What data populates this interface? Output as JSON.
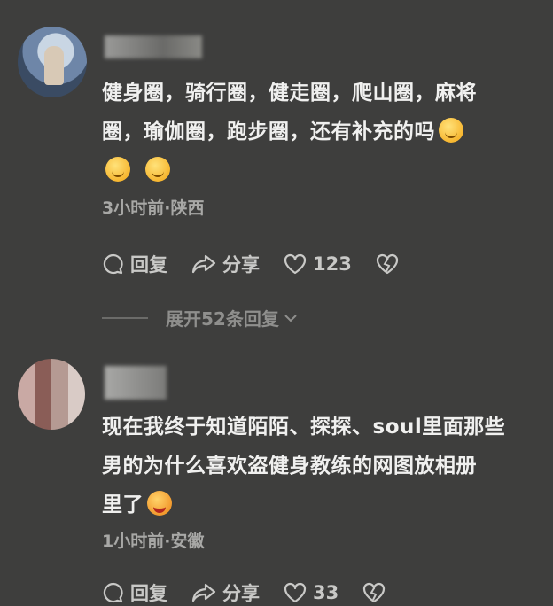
{
  "comments": [
    {
      "content_line1": "健身圈，骑行圈，健走圈，爬山圈，麻将",
      "content_line2": "圈，瑜伽圈，跑步圈，还有补充的吗",
      "meta": "3小时前·陕西",
      "reply_label": "回复",
      "share_label": "分享",
      "like_count": "123",
      "expand_label": "展开52条回复"
    },
    {
      "content_line1": "现在我终于知道陌陌、探探、soul里面那些",
      "content_line2": "男的为什么喜欢盗健身教练的网图放相册",
      "content_line3": "里了",
      "meta": "1小时前·安徽",
      "reply_label": "回复",
      "share_label": "分享",
      "like_count": "33"
    }
  ],
  "icons": [
    "comment-icon",
    "share-icon",
    "heart-icon",
    "dislike-heart-icon",
    "chevron-down-icon",
    "smirk-emoji",
    "laugh-emoji"
  ]
}
